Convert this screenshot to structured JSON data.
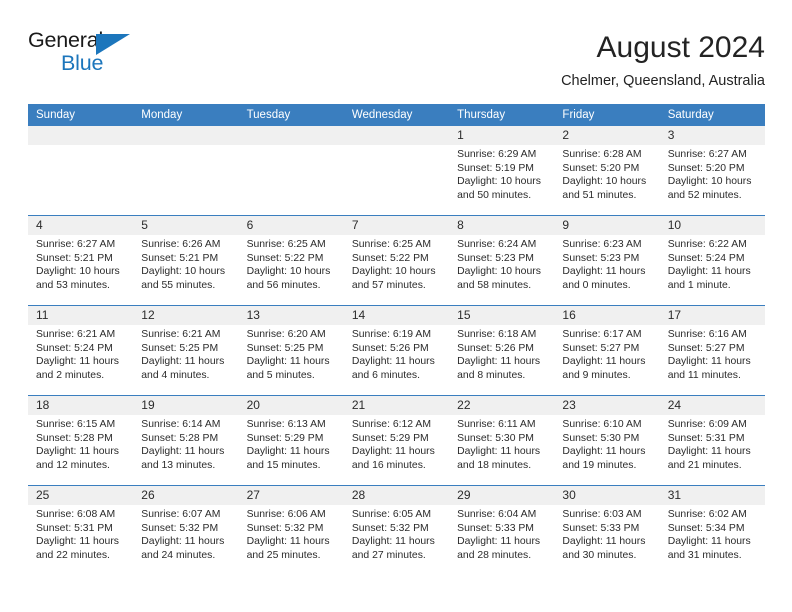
{
  "brand": {
    "name_top": "General",
    "name_bottom": "Blue",
    "color_blue": "#1c76bc",
    "color_dark": "#1a1a1a"
  },
  "header": {
    "title": "August 2024",
    "subtitle": "Chelmer, Queensland, Australia"
  },
  "theme": {
    "header_bar": "#3a7ebf",
    "daynum_band": "#f0f0f0",
    "row_divider": "#3a7ebf",
    "text": "#2b2b2b"
  },
  "weekdays": [
    "Sunday",
    "Monday",
    "Tuesday",
    "Wednesday",
    "Thursday",
    "Friday",
    "Saturday"
  ],
  "weeks": [
    [
      {
        "day": "",
        "sunrise": "",
        "sunset": "",
        "daylight": "",
        "empty": true
      },
      {
        "day": "",
        "sunrise": "",
        "sunset": "",
        "daylight": "",
        "empty": true
      },
      {
        "day": "",
        "sunrise": "",
        "sunset": "",
        "daylight": "",
        "empty": true
      },
      {
        "day": "",
        "sunrise": "",
        "sunset": "",
        "daylight": "",
        "empty": true
      },
      {
        "day": "1",
        "sunrise": "Sunrise: 6:29 AM",
        "sunset": "Sunset: 5:19 PM",
        "daylight": "Daylight: 10 hours and 50 minutes."
      },
      {
        "day": "2",
        "sunrise": "Sunrise: 6:28 AM",
        "sunset": "Sunset: 5:20 PM",
        "daylight": "Daylight: 10 hours and 51 minutes."
      },
      {
        "day": "3",
        "sunrise": "Sunrise: 6:27 AM",
        "sunset": "Sunset: 5:20 PM",
        "daylight": "Daylight: 10 hours and 52 minutes."
      }
    ],
    [
      {
        "day": "4",
        "sunrise": "Sunrise: 6:27 AM",
        "sunset": "Sunset: 5:21 PM",
        "daylight": "Daylight: 10 hours and 53 minutes."
      },
      {
        "day": "5",
        "sunrise": "Sunrise: 6:26 AM",
        "sunset": "Sunset: 5:21 PM",
        "daylight": "Daylight: 10 hours and 55 minutes."
      },
      {
        "day": "6",
        "sunrise": "Sunrise: 6:25 AM",
        "sunset": "Sunset: 5:22 PM",
        "daylight": "Daylight: 10 hours and 56 minutes."
      },
      {
        "day": "7",
        "sunrise": "Sunrise: 6:25 AM",
        "sunset": "Sunset: 5:22 PM",
        "daylight": "Daylight: 10 hours and 57 minutes."
      },
      {
        "day": "8",
        "sunrise": "Sunrise: 6:24 AM",
        "sunset": "Sunset: 5:23 PM",
        "daylight": "Daylight: 10 hours and 58 minutes."
      },
      {
        "day": "9",
        "sunrise": "Sunrise: 6:23 AM",
        "sunset": "Sunset: 5:23 PM",
        "daylight": "Daylight: 11 hours and 0 minutes."
      },
      {
        "day": "10",
        "sunrise": "Sunrise: 6:22 AM",
        "sunset": "Sunset: 5:24 PM",
        "daylight": "Daylight: 11 hours and 1 minute."
      }
    ],
    [
      {
        "day": "11",
        "sunrise": "Sunrise: 6:21 AM",
        "sunset": "Sunset: 5:24 PM",
        "daylight": "Daylight: 11 hours and 2 minutes."
      },
      {
        "day": "12",
        "sunrise": "Sunrise: 6:21 AM",
        "sunset": "Sunset: 5:25 PM",
        "daylight": "Daylight: 11 hours and 4 minutes."
      },
      {
        "day": "13",
        "sunrise": "Sunrise: 6:20 AM",
        "sunset": "Sunset: 5:25 PM",
        "daylight": "Daylight: 11 hours and 5 minutes."
      },
      {
        "day": "14",
        "sunrise": "Sunrise: 6:19 AM",
        "sunset": "Sunset: 5:26 PM",
        "daylight": "Daylight: 11 hours and 6 minutes."
      },
      {
        "day": "15",
        "sunrise": "Sunrise: 6:18 AM",
        "sunset": "Sunset: 5:26 PM",
        "daylight": "Daylight: 11 hours and 8 minutes."
      },
      {
        "day": "16",
        "sunrise": "Sunrise: 6:17 AM",
        "sunset": "Sunset: 5:27 PM",
        "daylight": "Daylight: 11 hours and 9 minutes."
      },
      {
        "day": "17",
        "sunrise": "Sunrise: 6:16 AM",
        "sunset": "Sunset: 5:27 PM",
        "daylight": "Daylight: 11 hours and 11 minutes."
      }
    ],
    [
      {
        "day": "18",
        "sunrise": "Sunrise: 6:15 AM",
        "sunset": "Sunset: 5:28 PM",
        "daylight": "Daylight: 11 hours and 12 minutes."
      },
      {
        "day": "19",
        "sunrise": "Sunrise: 6:14 AM",
        "sunset": "Sunset: 5:28 PM",
        "daylight": "Daylight: 11 hours and 13 minutes."
      },
      {
        "day": "20",
        "sunrise": "Sunrise: 6:13 AM",
        "sunset": "Sunset: 5:29 PM",
        "daylight": "Daylight: 11 hours and 15 minutes."
      },
      {
        "day": "21",
        "sunrise": "Sunrise: 6:12 AM",
        "sunset": "Sunset: 5:29 PM",
        "daylight": "Daylight: 11 hours and 16 minutes."
      },
      {
        "day": "22",
        "sunrise": "Sunrise: 6:11 AM",
        "sunset": "Sunset: 5:30 PM",
        "daylight": "Daylight: 11 hours and 18 minutes."
      },
      {
        "day": "23",
        "sunrise": "Sunrise: 6:10 AM",
        "sunset": "Sunset: 5:30 PM",
        "daylight": "Daylight: 11 hours and 19 minutes."
      },
      {
        "day": "24",
        "sunrise": "Sunrise: 6:09 AM",
        "sunset": "Sunset: 5:31 PM",
        "daylight": "Daylight: 11 hours and 21 minutes."
      }
    ],
    [
      {
        "day": "25",
        "sunrise": "Sunrise: 6:08 AM",
        "sunset": "Sunset: 5:31 PM",
        "daylight": "Daylight: 11 hours and 22 minutes."
      },
      {
        "day": "26",
        "sunrise": "Sunrise: 6:07 AM",
        "sunset": "Sunset: 5:32 PM",
        "daylight": "Daylight: 11 hours and 24 minutes."
      },
      {
        "day": "27",
        "sunrise": "Sunrise: 6:06 AM",
        "sunset": "Sunset: 5:32 PM",
        "daylight": "Daylight: 11 hours and 25 minutes."
      },
      {
        "day": "28",
        "sunrise": "Sunrise: 6:05 AM",
        "sunset": "Sunset: 5:32 PM",
        "daylight": "Daylight: 11 hours and 27 minutes."
      },
      {
        "day": "29",
        "sunrise": "Sunrise: 6:04 AM",
        "sunset": "Sunset: 5:33 PM",
        "daylight": "Daylight: 11 hours and 28 minutes."
      },
      {
        "day": "30",
        "sunrise": "Sunrise: 6:03 AM",
        "sunset": "Sunset: 5:33 PM",
        "daylight": "Daylight: 11 hours and 30 minutes."
      },
      {
        "day": "31",
        "sunrise": "Sunrise: 6:02 AM",
        "sunset": "Sunset: 5:34 PM",
        "daylight": "Daylight: 11 hours and 31 minutes."
      }
    ]
  ]
}
